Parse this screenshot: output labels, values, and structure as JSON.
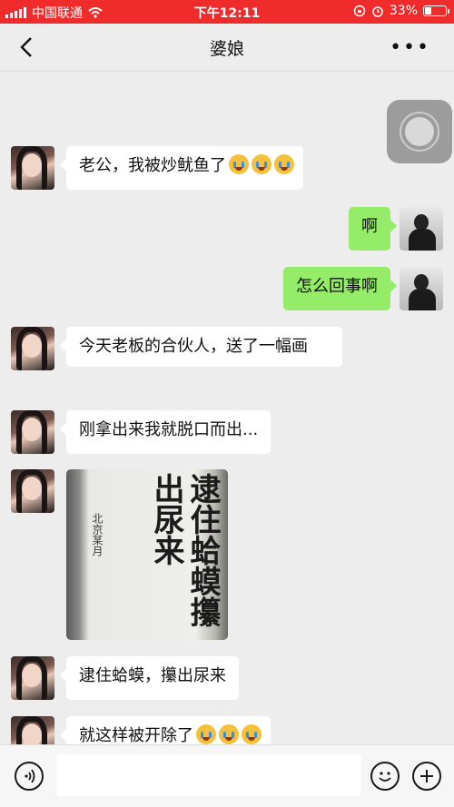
{
  "status_bar": {
    "carrier": "中国联通",
    "time": "下午12:11",
    "battery": "33%",
    "battery_level": 0.33
  },
  "nav": {
    "title": "婆娘",
    "more": "•••"
  },
  "messages": [
    {
      "side": "left",
      "text": "老公，我被炒鱿鱼了",
      "emoji_count": 3
    },
    {
      "side": "right",
      "text": "啊"
    },
    {
      "side": "right",
      "text": "怎么回事啊"
    },
    {
      "side": "left",
      "text": "今天老板的合伙人，送了一幅画"
    },
    {
      "side": "left",
      "text": "刚拿出来我就脱口而出..."
    },
    {
      "side": "left",
      "type": "image",
      "calligraphy": "逮住蛤蟆攥出尿来",
      "inscription": "北京某月"
    },
    {
      "side": "left",
      "text": "逮住蛤蟆，攥出尿来"
    },
    {
      "side": "left",
      "text": "就这样被开除了",
      "emoji_count": 3
    }
  ],
  "input": {
    "placeholder": ""
  },
  "colors": {
    "status_bar": "#f02b2b",
    "bubble_mine": "#95ec69",
    "bubble_theirs": "#ffffff",
    "background": "#ededed"
  },
  "icons": [
    "wifi-icon",
    "alarm-icon",
    "back-icon",
    "voice-icon",
    "emoji-icon",
    "plus-icon"
  ]
}
